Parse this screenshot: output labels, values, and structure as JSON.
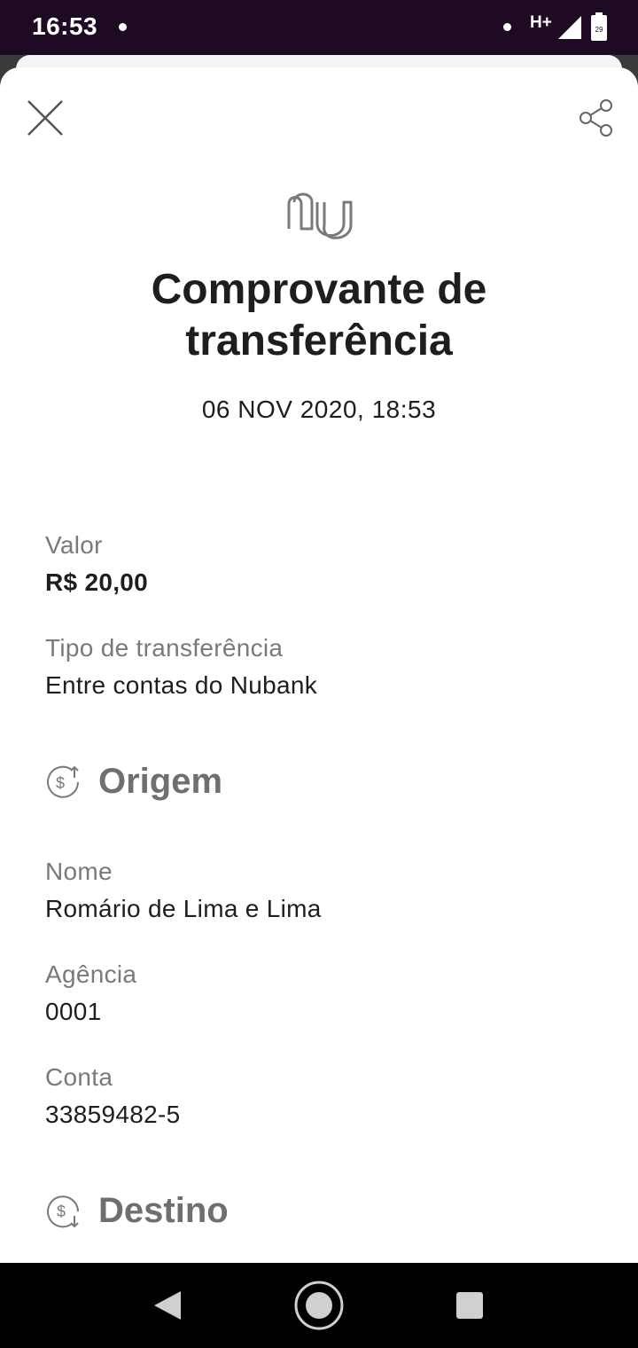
{
  "status_bar": {
    "time": "16:53",
    "network": "H+",
    "battery_level": "29"
  },
  "header": {
    "close_icon": "close-icon",
    "share_icon": "share-icon",
    "logo_text": "nu"
  },
  "receipt": {
    "title": "Comprovante de transferência",
    "date": "06 NOV 2020, 18:53",
    "valor_label": "Valor",
    "valor_value": "R$ 20,00",
    "tipo_label": "Tipo de transferência",
    "tipo_value": "Entre contas do Nubank"
  },
  "origem": {
    "title": "Origem",
    "icon": "money-up-icon",
    "nome_label": "Nome",
    "nome_value": "Romário de Lima e Lima",
    "agencia_label": "Agência",
    "agencia_value": "0001",
    "conta_label": "Conta",
    "conta_value": "33859482-5"
  },
  "destino": {
    "title": "Destino",
    "icon": "money-down-icon"
  },
  "colors": {
    "status_bar": "#1f0a24",
    "text_primary": "#1e1e1e",
    "text_secondary": "#7a7a7a"
  }
}
